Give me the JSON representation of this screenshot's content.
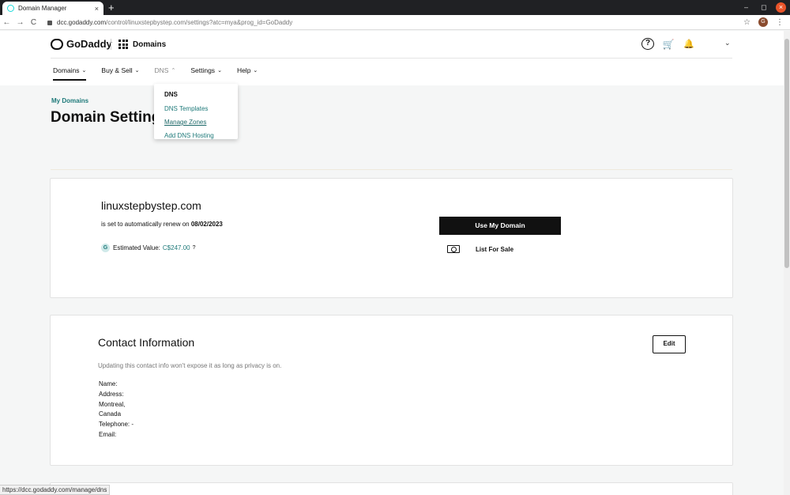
{
  "browser": {
    "tab_title": "Domain Manager",
    "tab_close": "×",
    "new_tab": "+",
    "url_host": "dcc.godaddy.com",
    "url_path": "/control/linuxstepbystep.com/settings?atc=mya&prog_id=GoDaddy",
    "nav_back": "←",
    "nav_forward": "→",
    "nav_reload": "C",
    "win_min": "–",
    "win_max": "◻",
    "win_close": "×",
    "star": "☆",
    "profile_initial": "G",
    "menu_dots": "⋮",
    "status_url": "https://dcc.godaddy.com/manage/dns"
  },
  "header": {
    "logo_text": "GoDaddy",
    "product": "Domains",
    "help_glyph": "?",
    "cart_glyph": "🛒",
    "bell_glyph": "🔔",
    "account_chevron": "⌄"
  },
  "nav": {
    "items": [
      {
        "label": "Domains"
      },
      {
        "label": "Buy & Sell"
      },
      {
        "label": "DNS"
      },
      {
        "label": "Settings"
      },
      {
        "label": "Help"
      }
    ],
    "chevron_down": "⌄",
    "chevron_up": "⌃"
  },
  "dns_menu": {
    "heading": "DNS",
    "items": [
      "DNS Templates",
      "Manage Zones",
      "Add DNS Hosting"
    ]
  },
  "breadcrumb": "My Domains",
  "page_title": "Domain Settings",
  "domain_card": {
    "domain": "linuxstepbystep.com",
    "renew_prefix": "is set to automatically renew on ",
    "renew_date": "08/02/2023",
    "badge": "G",
    "estimated_label": "Estimated Value:",
    "estimated_value": "C$247.00",
    "info_glyph": "?",
    "use_button": "Use My Domain",
    "list_for_sale": "List For Sale"
  },
  "contact_card": {
    "title": "Contact Information",
    "note": "Updating this contact info won't expose it as long as privacy is on.",
    "edit_button": "Edit",
    "lines": [
      "Name:",
      "Address:",
      "Montreal,",
      "Canada",
      "Telephone: -",
      "Email:"
    ]
  }
}
